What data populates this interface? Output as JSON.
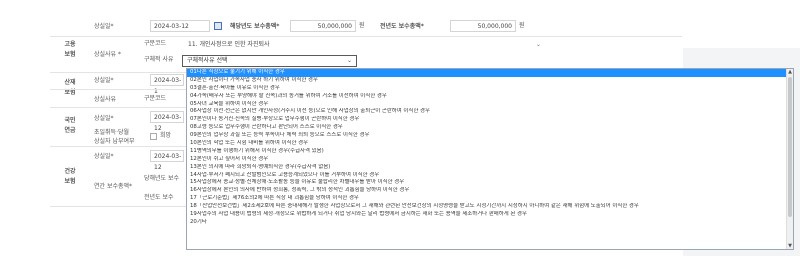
{
  "colors": {
    "selected": "#1e90ff",
    "required": "#e74c3c",
    "link": "#3355cc"
  },
  "employment": {
    "group": "고용\n보험",
    "loss_date_label": "상실일*",
    "loss_date_value": "2024-03-12",
    "year_total_label": "해당년도 보수총액*",
    "year_total_value": "50,000,000",
    "prev_total_label": "전년도 보수총액*",
    "prev_total_value": "50,000,000",
    "unit": "원",
    "reason_label": "상실사유 *",
    "code_label": "구분코드",
    "code_value": "11. 개인사정으로 인한 자진퇴사",
    "detail_label": "구체적 사유",
    "detail_value": "구체적사유 선택"
  },
  "industrial": {
    "group": "산재\n보험",
    "loss_date_label": "상실일*",
    "loss_date_value": "2024-03-1",
    "reason_label": "상실사유",
    "code_label": "구분코드"
  },
  "pension": {
    "group": "국민\n연금",
    "loss_date_label": "상실일*",
    "loss_date_value": "2024-03-12",
    "extra_label": "초일취득·당월\n상실자 납부여부",
    "check_label": "희망"
  },
  "health": {
    "group": "건강\n보험",
    "loss_date_label": "상실일*",
    "loss_date_value": "2024-03-12",
    "annual_label": "연간 보수총액*",
    "this_year_label": "당해년도 보수",
    "prev_year_label": "전년도 보수"
  },
  "side_code": "0019",
  "dropdown": {
    "selected_index": 0,
    "options": [
      "01다른 직장으로 옮기기 위해 이직한 경우",
      "02본인 사업이나 가족사업 종사 하기 위하여 이직한 경우",
      "03결혼·출산·육아를 이유로 이직한 경우",
      "04가족(배우자 또는 부양해야 할 친족)과의 동거를 위하여 거소를 이전하여 이직한 경우",
      "05자녀 교육을 위하여 이직한 경우",
      "06사업장 이전·전근은 없지만 개인사정(거주지 이전 등)으로 인해 사업장의 출퇴근이 곤란하여 이직한 경우",
      "07본인이나 동거친·친족의 질병·부상으로 업무수행이 곤란하여 이직한 경우",
      "08고령 등으로 업무수행이 곤란하다고 판단되어 스스로 이직한 경우",
      "09본인의 업무상 과실 또는 능력 부족이나 체력 쇠퇴 등으로 스스로 이직한 경우",
      "10본인의 학업 또는 시험 대비를 위하여 이직한 경우",
      "11병역의무를 이행하기 위해서 이직한 경우(수급자격 있음)",
      "12본인이 쉬고 싶어서 이직한 경우",
      "13본인 의지에 따라 희망퇴직·명예퇴직한 경우(수급자격 없음)",
      "14사업·부서가 폐지되고 산발범인으로 고용승계되었으나 이를 거부하여 이직한 경우",
      "15사업장에서 종교·성별·신체장애·노조활동 등을 이유로 불합리한 차별대우를 받아 이직한 경우",
      "16사업장에서 본인의 의사에 반하여 성희롱, 성폭력, 그 밖의 성적인 괴롭힘을 당하여 이직한 경우",
      "17「근로기준법」제76조의2에 따른 직장 내 괴롭힘을 당하여 이직한 경우",
      "18「산업안전보건법」제2조제2호에 따른 중대재해가 발생한 사업장으로서 그 재해와 관련된 안전보건상의 시정명령을 받고도 시정기간까지 시정하지 아니하여 같은 재해 위험에 노출되어 이직한 경우",
      "19사업주의 사업 내용이 법령의 제정·개정으로 위법하게 되거나 취업 당시와는 달리 법령에서 금지하는 재화 또는 용역을 제조하거나 판매하게 된 경우",
      "20기타"
    ]
  }
}
